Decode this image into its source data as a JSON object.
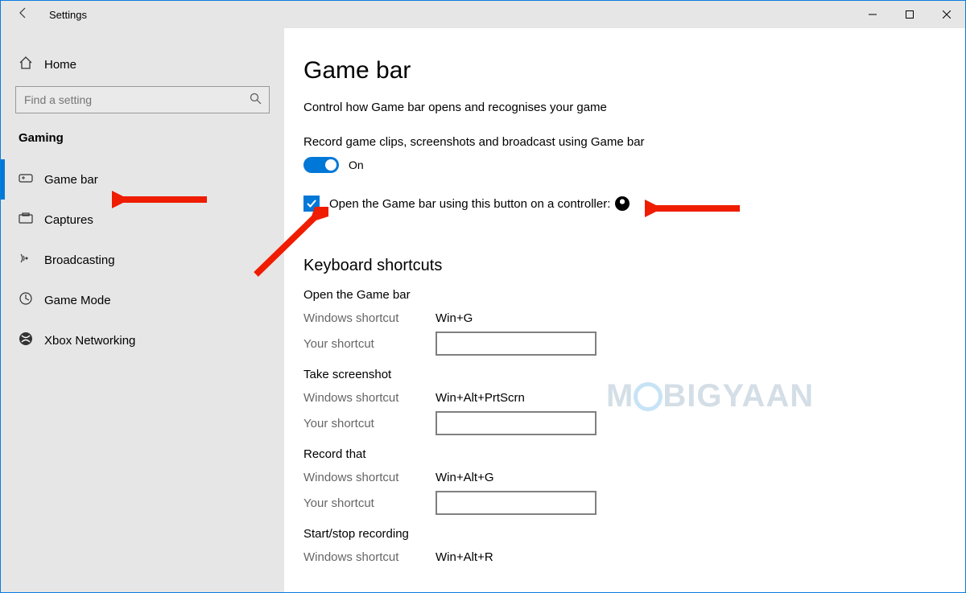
{
  "titlebar": {
    "title": "Settings"
  },
  "sidebar": {
    "home": "Home",
    "search_placeholder": "Find a setting",
    "category": "Gaming",
    "items": [
      {
        "label": "Game bar"
      },
      {
        "label": "Captures"
      },
      {
        "label": "Broadcasting"
      },
      {
        "label": "Game Mode"
      },
      {
        "label": "Xbox Networking"
      }
    ]
  },
  "content": {
    "title": "Game bar",
    "subtitle": "Control how Game bar opens and recognises your game",
    "record_label": "Record game clips, screenshots and broadcast using Game bar",
    "toggle_state": "On",
    "controller_label": "Open the Game bar using this button on a controller:",
    "shortcuts_header": "Keyboard shortcuts",
    "windows_shortcut_label": "Windows shortcut",
    "your_shortcut_label": "Your shortcut",
    "shortcuts": [
      {
        "name": "Open the Game bar",
        "win": "Win+G",
        "your": ""
      },
      {
        "name": "Take screenshot",
        "win": "Win+Alt+PrtScrn",
        "your": ""
      },
      {
        "name": "Record that",
        "win": "Win+Alt+G",
        "your": ""
      },
      {
        "name": "Start/stop recording",
        "win": "Win+Alt+R",
        "your": ""
      }
    ]
  },
  "watermark": "MOBIGYAAN"
}
